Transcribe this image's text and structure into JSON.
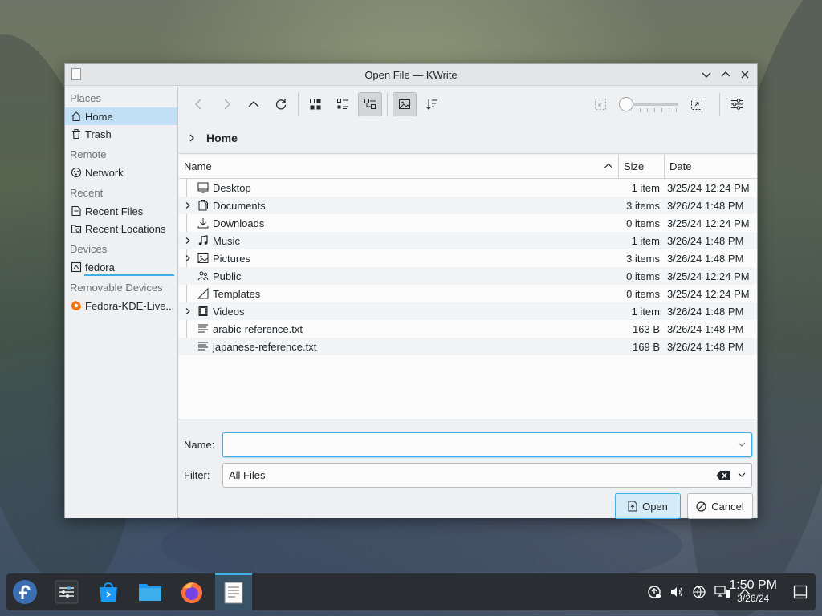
{
  "window": {
    "title": "Open File — KWrite"
  },
  "sidebar": {
    "sections": [
      {
        "heading": "Places",
        "items": [
          {
            "label": "Home",
            "icon": "home-icon",
            "active": true
          },
          {
            "label": "Trash",
            "icon": "trash-icon"
          }
        ]
      },
      {
        "heading": "Remote",
        "items": [
          {
            "label": "Network",
            "icon": "network-icon"
          }
        ]
      },
      {
        "heading": "Recent",
        "items": [
          {
            "label": "Recent Files",
            "icon": "recent-files-icon"
          },
          {
            "label": "Recent Locations",
            "icon": "recent-locations-icon"
          }
        ]
      },
      {
        "heading": "Devices",
        "items": [
          {
            "label": "fedora",
            "icon": "drive-icon"
          }
        ]
      },
      {
        "heading": "Removable Devices",
        "items": [
          {
            "label": "Fedora-KDE-Live...",
            "icon": "optical-disc-icon"
          }
        ]
      }
    ]
  },
  "breadcrumb": {
    "current": "Home"
  },
  "filelist": {
    "columns": {
      "name": "Name",
      "size": "Size",
      "date": "Date"
    },
    "rows": [
      {
        "name": "Desktop",
        "size": "1 item",
        "date": "3/25/24 12:24 PM",
        "expandable": false,
        "icon": "desktop-folder-icon"
      },
      {
        "name": "Documents",
        "size": "3 items",
        "date": "3/26/24 1:48 PM",
        "expandable": true,
        "icon": "documents-folder-icon"
      },
      {
        "name": "Downloads",
        "size": "0 items",
        "date": "3/25/24 12:24 PM",
        "expandable": false,
        "icon": "downloads-folder-icon"
      },
      {
        "name": "Music",
        "size": "1 item",
        "date": "3/26/24 1:48 PM",
        "expandable": true,
        "icon": "music-folder-icon"
      },
      {
        "name": "Pictures",
        "size": "3 items",
        "date": "3/26/24 1:48 PM",
        "expandable": true,
        "icon": "pictures-folder-icon"
      },
      {
        "name": "Public",
        "size": "0 items",
        "date": "3/25/24 12:24 PM",
        "expandable": false,
        "icon": "public-folder-icon"
      },
      {
        "name": "Templates",
        "size": "0 items",
        "date": "3/25/24 12:24 PM",
        "expandable": false,
        "icon": "templates-folder-icon"
      },
      {
        "name": "Videos",
        "size": "1 item",
        "date": "3/26/24 1:48 PM",
        "expandable": true,
        "icon": "videos-folder-icon"
      },
      {
        "name": "arabic-reference.txt",
        "size": "163 B",
        "date": "3/26/24 1:48 PM",
        "expandable": false,
        "icon": "text-file-icon"
      },
      {
        "name": "japanese-reference.txt",
        "size": "169 B",
        "date": "3/26/24 1:48 PM",
        "expandable": false,
        "icon": "text-file-icon"
      }
    ]
  },
  "form": {
    "name_label": "Name:",
    "name_value": "",
    "filter_label": "Filter:",
    "filter_value": "All Files",
    "open_label": "Open",
    "cancel_label": "Cancel"
  },
  "zoom": {
    "level": 0.0
  },
  "taskbar": {
    "time": "1:50 PM",
    "date": "3/26/24"
  },
  "colors": {
    "accent": "#3daee9",
    "selection": "#c2e0f5",
    "taskbar": "#2a2e32"
  }
}
